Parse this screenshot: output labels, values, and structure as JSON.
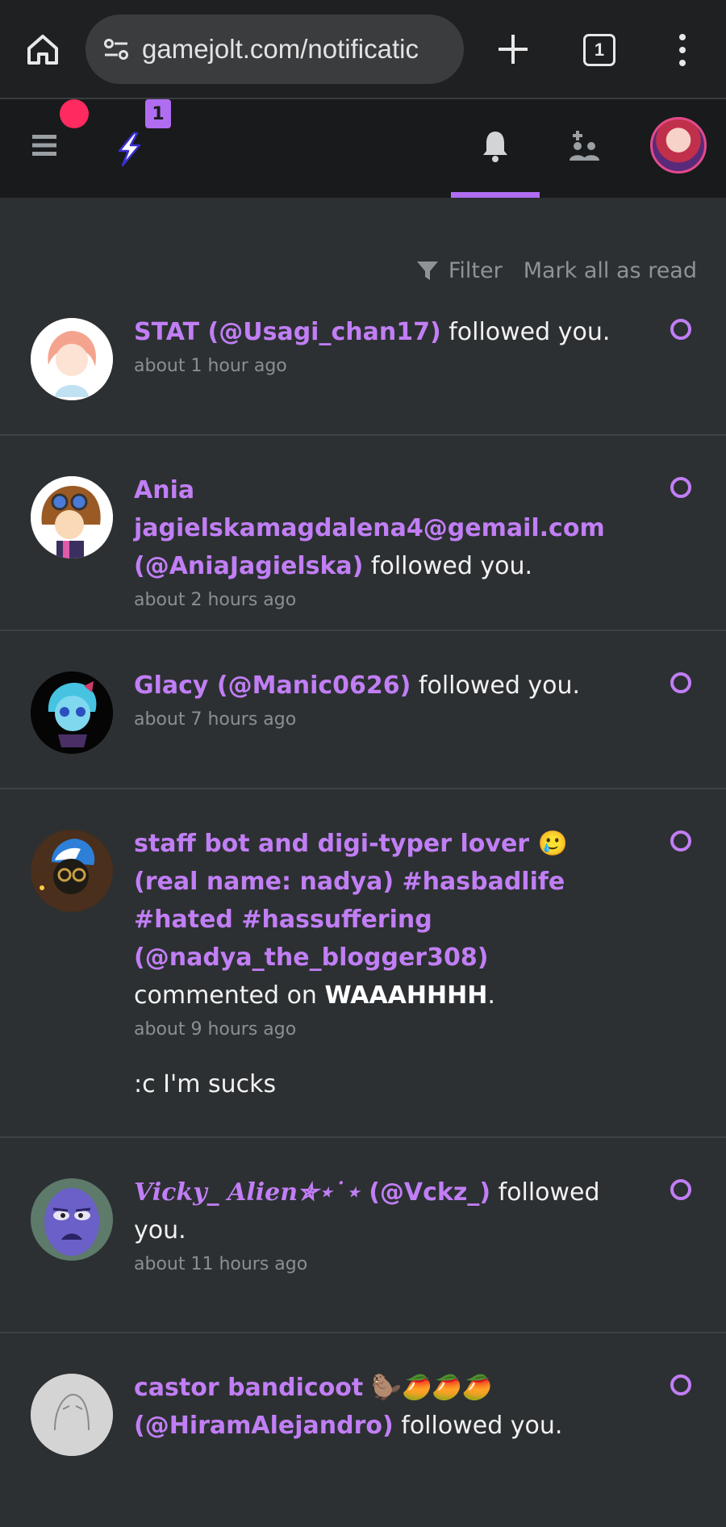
{
  "browser": {
    "url": "gamejolt.com/notificatic",
    "tab_count": "1"
  },
  "header": {
    "bolt_badge": "1"
  },
  "toolbar": {
    "filter_label": "Filter",
    "mark_all_label": "Mark all as read"
  },
  "notifications": [
    {
      "name": "STAT (@Usagi_chan17)",
      "action": " followed you.",
      "time": "about 1 hour ago"
    },
    {
      "name": "Ania jagielskamagdalena4@gemail.com (@AniaJagielska)",
      "action": " followed you.",
      "time": "about 2 hours ago"
    },
    {
      "name": "Glacy (@Manic0626)",
      "action": " followed you.",
      "time": "about 7 hours ago"
    },
    {
      "name": "staff bot and digi-typer lover 🥲 (real name: nadya) #hasbadlife #hated #hassuffering (@nadya_the_blogger308)",
      "action": " commented on ",
      "target": "WAAAHHHH",
      "action_end": ".",
      "time": "about 9 hours ago",
      "comment": ":c I'm sucks"
    },
    {
      "name_script": "Vicky_ Alien✯⋆˙⋆",
      "name": " (@Vckz_)",
      "action": " followed you.",
      "time": "about 11 hours ago"
    },
    {
      "name": "castor bandicoot 🦫🥭🥭🥭 (@HiramAlejandro)",
      "action": " followed you."
    }
  ]
}
